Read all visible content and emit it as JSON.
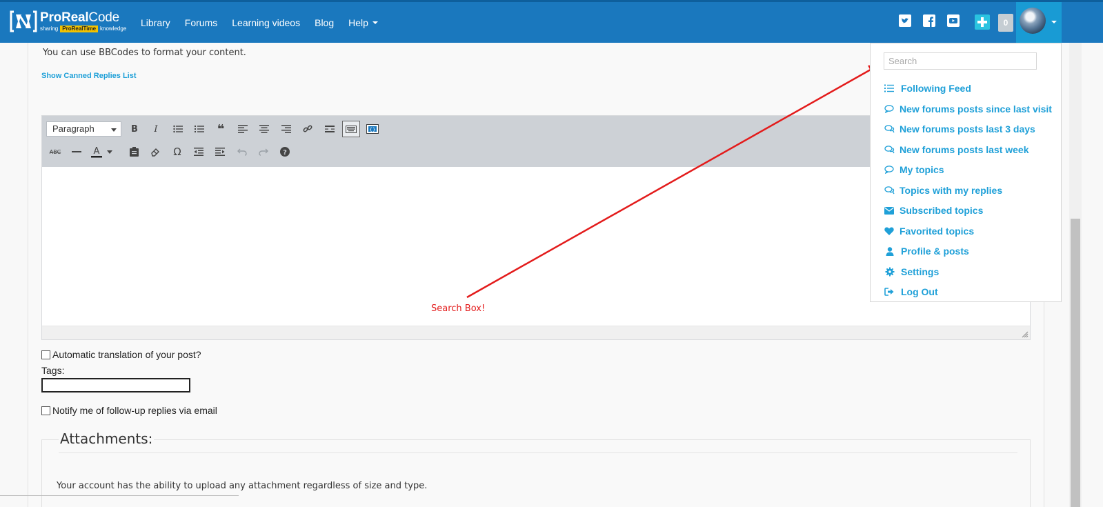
{
  "brand": {
    "name_bold": "ProReal",
    "name_light": "Code",
    "tag_left": "sharing",
    "tag_mid": "ProRealTime",
    "tag_right": "knowledge"
  },
  "nav": {
    "items": [
      "Library",
      "Forums",
      "Learning videos",
      "Blog",
      "Help"
    ]
  },
  "header": {
    "notification_count": "0"
  },
  "page": {
    "bbcode_note": "You can use BBCodes to format your content.",
    "canned_link": "Show Canned Replies List"
  },
  "editor": {
    "format_select": "Paragraph"
  },
  "annotation": {
    "text": "Search Box!",
    "color": "#e31b1b"
  },
  "form": {
    "auto_translate": "Automatic translation of your post?",
    "tags_label": "Tags:",
    "notify": "Notify me of follow-up replies via email"
  },
  "attachments": {
    "title": "Attachments:",
    "note": "Your account has the ability to upload any attachment regardless of size and type."
  },
  "dropdown": {
    "search_placeholder": "Search",
    "items": [
      {
        "label": "Following Feed",
        "icon": "list-icon"
      },
      {
        "label": "New forums posts since last visit",
        "icon": "comment-icon"
      },
      {
        "label": "New forums posts last 3 days",
        "icon": "comments-icon"
      },
      {
        "label": "New forums posts last week",
        "icon": "comments-icon"
      },
      {
        "label": "My topics",
        "icon": "comment-icon"
      },
      {
        "label": "Topics with my replies",
        "icon": "comments-icon"
      },
      {
        "label": "Subscribed topics",
        "icon": "envelope-icon"
      },
      {
        "label": "Favorited topics",
        "icon": "heart-icon"
      },
      {
        "label": "Profile & posts",
        "icon": "user-icon"
      },
      {
        "label": "Settings",
        "icon": "gear-icon"
      },
      {
        "label": "Log Out",
        "icon": "sign-out-icon"
      }
    ]
  },
  "colors": {
    "nav_bg": "#1a78be",
    "link": "#1fa0d8",
    "accent_plus": "#2ac3e0"
  }
}
